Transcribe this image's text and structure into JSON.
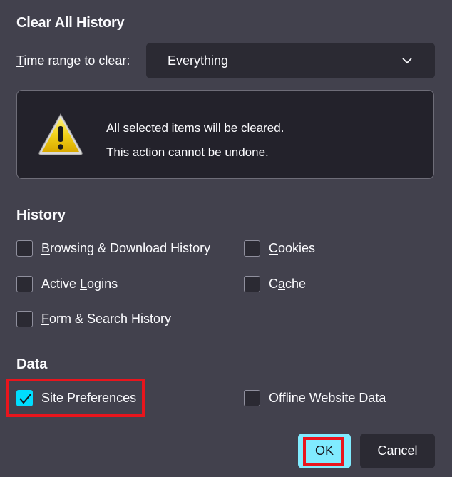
{
  "dialog": {
    "title": "Clear All History",
    "time_range": {
      "label_accel": "T",
      "label_rest": "ime range to clear:",
      "selected": "Everything"
    },
    "warning": {
      "icon": "warning-triangle-icon",
      "line1": "All selected items will be cleared.",
      "line2": "This action cannot be undone."
    },
    "history": {
      "heading": "History",
      "items": [
        {
          "pre": "",
          "accel": "B",
          "post": "rowsing & Download History",
          "checked": false
        },
        {
          "pre": "",
          "accel": "C",
          "post": "ookies",
          "checked": false
        },
        {
          "pre": "Active ",
          "accel": "L",
          "post": "ogins",
          "checked": false
        },
        {
          "pre": "C",
          "accel": "a",
          "post": "che",
          "checked": false
        },
        {
          "pre": "",
          "accel": "F",
          "post": "orm & Search History",
          "checked": false
        }
      ]
    },
    "data": {
      "heading": "Data",
      "items": [
        {
          "pre": "",
          "accel": "S",
          "post": "ite Preferences",
          "checked": true
        },
        {
          "pre": "",
          "accel": "O",
          "post": "ffline Website Data",
          "checked": false
        }
      ]
    },
    "buttons": {
      "ok": "OK",
      "cancel": "Cancel"
    },
    "colors": {
      "background": "#42414d",
      "accent": "#00ddff",
      "ok_button": "#80ebff",
      "highlight": "#e8151d"
    }
  }
}
